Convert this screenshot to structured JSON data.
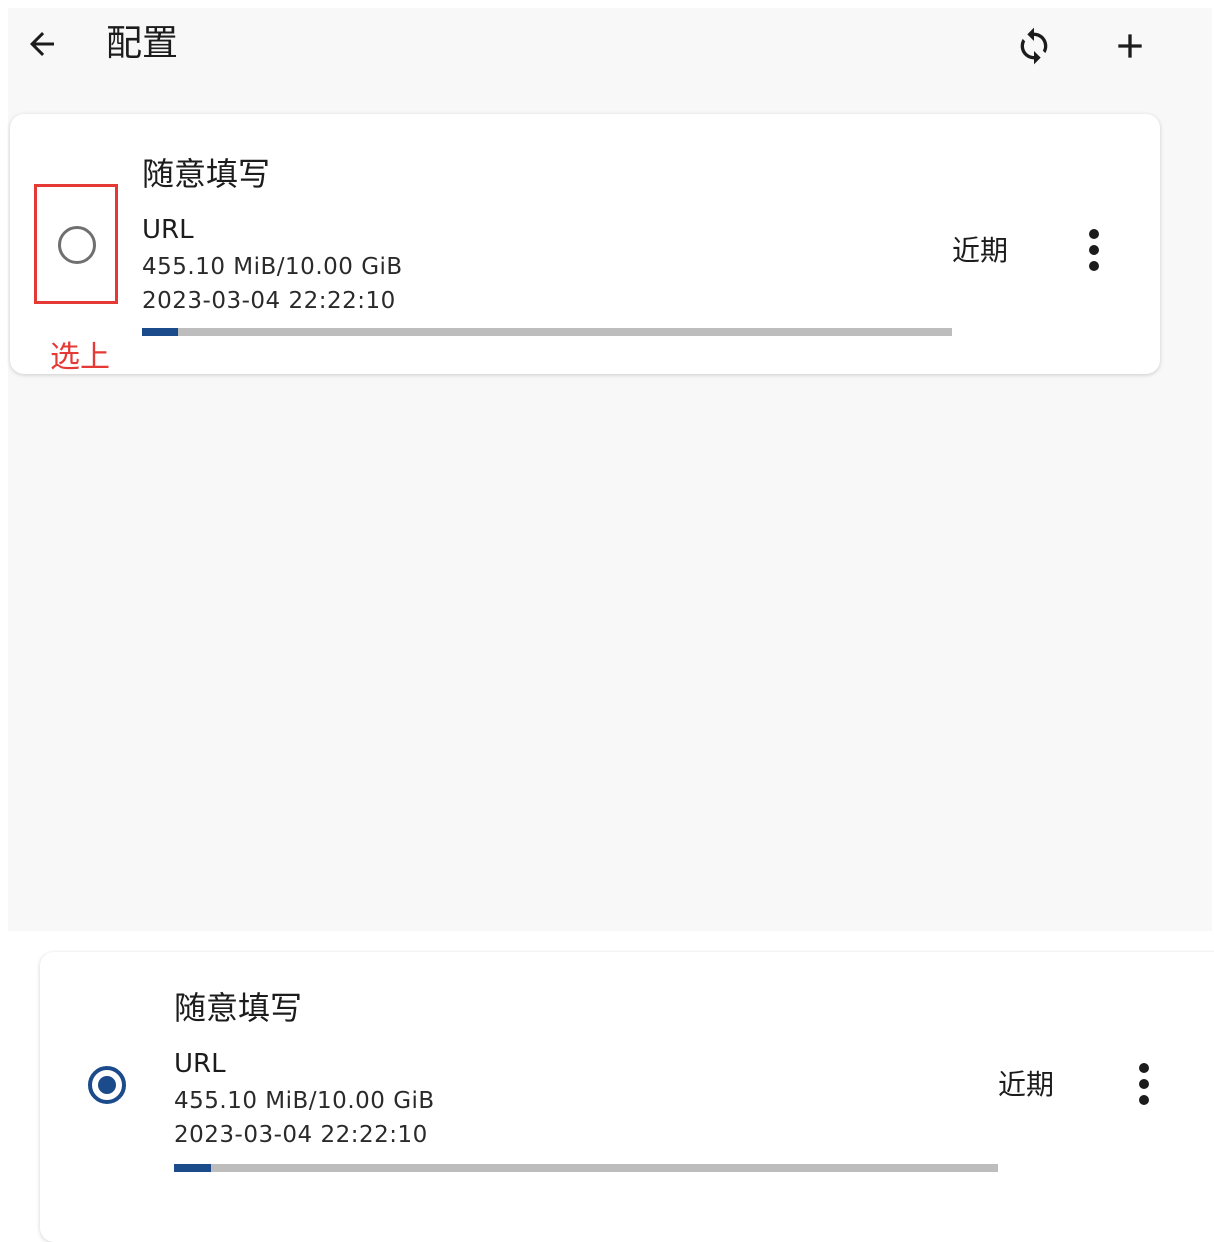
{
  "appbar": {
    "title": "配置",
    "icons": {
      "back": "arrow-back-icon",
      "sync": "sync-icon",
      "add": "add-icon"
    }
  },
  "annotation": {
    "label": "选上",
    "color": "#e53935"
  },
  "colors": {
    "accent": "#1b4b8a",
    "track": "#bdbdbd",
    "background": "#f8f8f8"
  },
  "profiles": [
    {
      "name": "随意填写",
      "url": "URL",
      "usage": "455.10 MiB/10.00 GiB",
      "updated": "2023-03-04 22:22:10",
      "recent": "近期",
      "selected": false,
      "usage_fraction": 0.0444
    },
    {
      "name": "随意填写",
      "url": "URL",
      "usage": "455.10 MiB/10.00 GiB",
      "updated": "2023-03-04 22:22:10",
      "recent": "近期",
      "selected": true,
      "usage_fraction": 0.0444
    }
  ]
}
